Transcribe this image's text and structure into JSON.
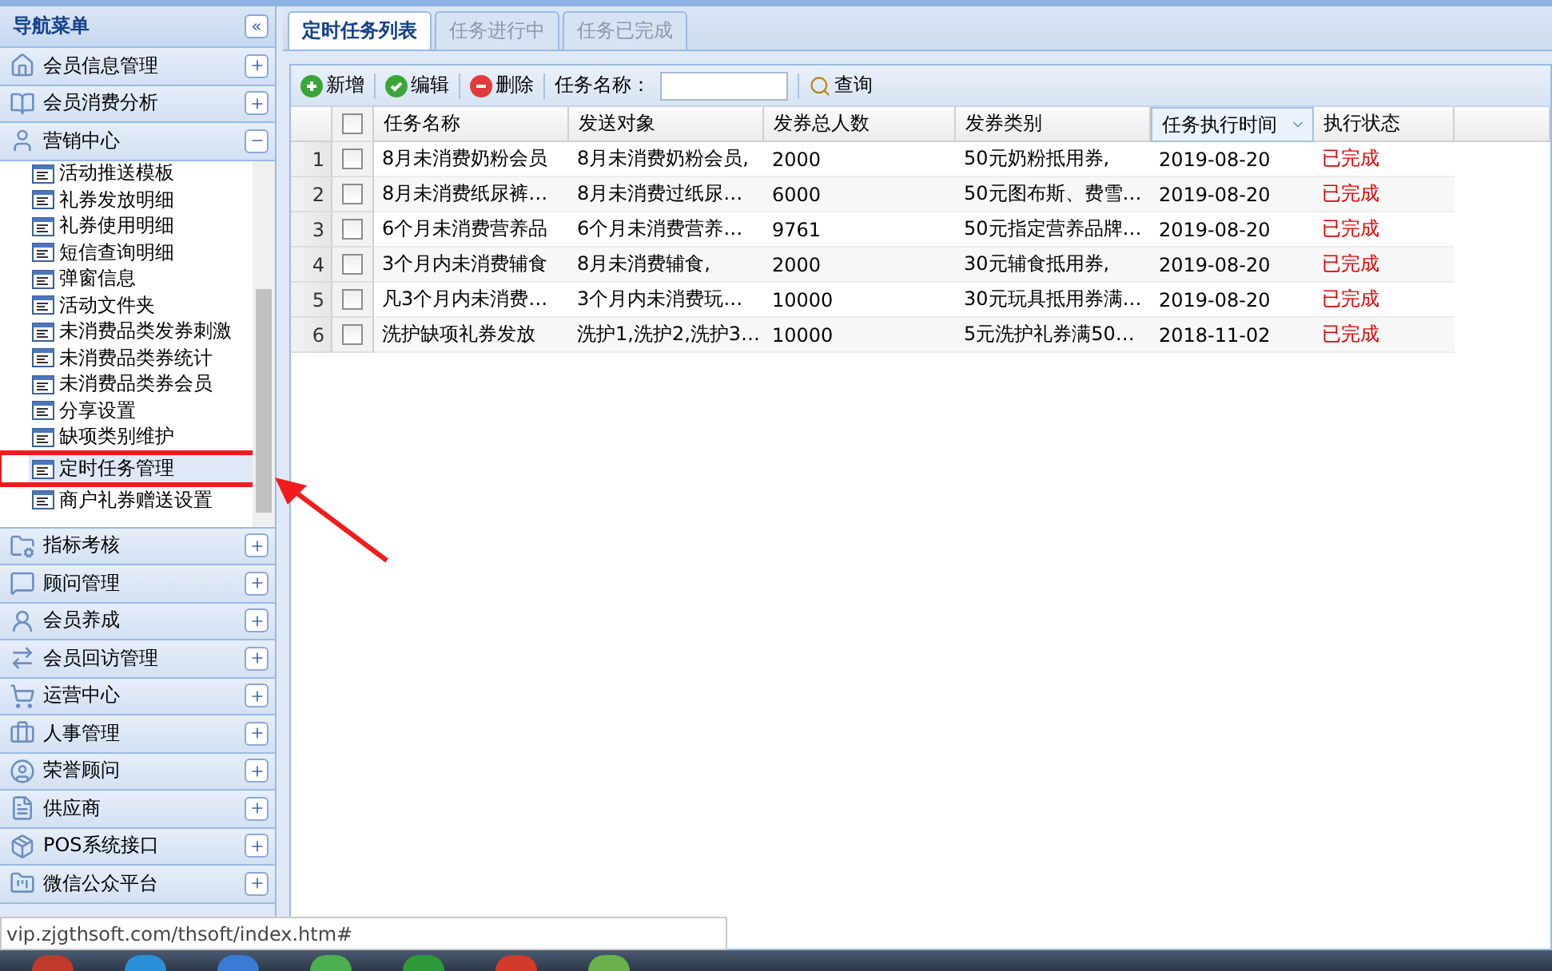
{
  "sidebar": {
    "title": "导航菜单",
    "collapse_glyph": "«",
    "sections": [
      {
        "label": "会员信息管理",
        "expanded": false
      },
      {
        "label": "会员消费分析",
        "expanded": false
      },
      {
        "label": "营销中心",
        "expanded": true,
        "items": [
          {
            "label": "活动推送模板",
            "selected": false
          },
          {
            "label": "礼券发放明细",
            "selected": false
          },
          {
            "label": "礼券使用明细",
            "selected": false
          },
          {
            "label": "短信查询明细",
            "selected": false
          },
          {
            "label": "弹窗信息",
            "selected": false
          },
          {
            "label": "活动文件夹",
            "selected": false
          },
          {
            "label": "未消费品类发券刺激",
            "selected": false
          },
          {
            "label": "未消费品类券统计",
            "selected": false
          },
          {
            "label": "未消费品类券会员",
            "selected": false
          },
          {
            "label": "分享设置",
            "selected": false
          },
          {
            "label": "缺项类别维护",
            "selected": false
          },
          {
            "label": "定时任务管理",
            "selected": true
          },
          {
            "label": "商户礼券赠送设置",
            "selected": false
          }
        ]
      },
      {
        "label": "指标考核",
        "expanded": false
      },
      {
        "label": "顾问管理",
        "expanded": false
      },
      {
        "label": "会员养成",
        "expanded": false
      },
      {
        "label": "会员回访管理",
        "expanded": false
      },
      {
        "label": "运营中心",
        "expanded": false
      },
      {
        "label": "人事管理",
        "expanded": false
      },
      {
        "label": "荣誉顾问",
        "expanded": false
      },
      {
        "label": "供应商",
        "expanded": false
      },
      {
        "label": "POS系统接口",
        "expanded": false
      },
      {
        "label": "微信公众平台",
        "expanded": false
      }
    ]
  },
  "tabs": [
    {
      "label": "定时任务列表",
      "selected": true
    },
    {
      "label": "任务进行中",
      "selected": false
    },
    {
      "label": "任务已完成",
      "selected": false
    }
  ],
  "toolbar": {
    "buttons": [
      {
        "kind": "add",
        "label": "新增"
      },
      {
        "kind": "edit",
        "label": "编辑"
      },
      {
        "kind": "delete",
        "label": "删除"
      }
    ],
    "search_label": "任务名称：",
    "search_button": "查询"
  },
  "table": {
    "columns": [
      {
        "label": "任务名称",
        "sorted": false
      },
      {
        "label": "发送对象",
        "sorted": false
      },
      {
        "label": "发券总人数",
        "sorted": false
      },
      {
        "label": "发券类别",
        "sorted": false
      },
      {
        "label": "任务执行时间",
        "sorted": true
      },
      {
        "label": "执行状态",
        "sorted": false
      }
    ],
    "header_checked": false,
    "rows": [
      {
        "index": "1",
        "checked": false,
        "cells": [
          "8月未消费奶粉会员",
          "8月未消费奶粉会员,",
          "2000",
          "50元奶粉抵用券,",
          "2019-08-20",
          "已完成"
        ]
      },
      {
        "index": "2",
        "checked": false,
        "cells": [
          "8月未消费纸尿裤…",
          "8月未消费过纸尿…",
          "6000",
          "50元图布斯、费雪…",
          "2019-08-20",
          "已完成"
        ]
      },
      {
        "index": "3",
        "checked": false,
        "cells": [
          "6个月未消费营养品",
          "6个月未消费营养…",
          "9761",
          "50元指定营养品牌…",
          "2019-08-20",
          "已完成"
        ]
      },
      {
        "index": "4",
        "checked": false,
        "cells": [
          "3个月内未消费辅食",
          "8月未消费辅食,",
          "2000",
          "30元辅食抵用券,",
          "2019-08-20",
          "已完成"
        ]
      },
      {
        "index": "5",
        "checked": false,
        "cells": [
          "凡3个月内未消费…",
          "3个月内未消费玩…",
          "10000",
          "30元玩具抵用券满…",
          "2019-08-20",
          "已完成"
        ]
      },
      {
        "index": "6",
        "checked": false,
        "cells": [
          "洗护缺项礼券发放",
          "洗护1,洗护2,洗护3…",
          "10000",
          "5元洗护礼券满50…",
          "2018-11-02",
          "已完成"
        ]
      }
    ]
  },
  "status_url": "vip.zjgthsoft.com/thsoft/index.htm#"
}
